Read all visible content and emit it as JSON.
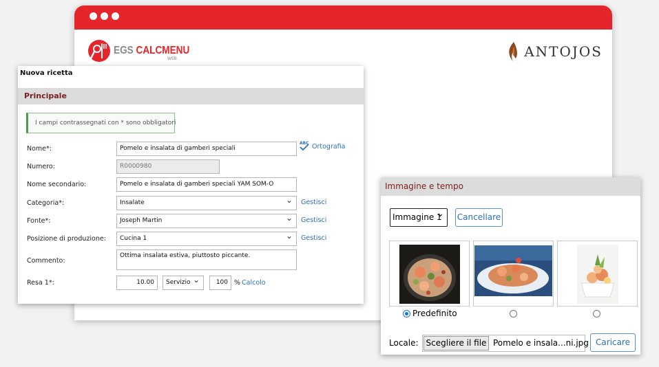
{
  "brand": {
    "egs": "EGS",
    "calcmenu": "CALCMENU",
    "web": "WEB",
    "partner": "ANTOJOS"
  },
  "recipe": {
    "title": "Nuova ricetta",
    "section": "Principale",
    "notice": "I campi contrassegnati con * sono obbligatori",
    "spell_link": "Ortografia",
    "manage_link": "Gestisci",
    "calc_link": "Calcolo",
    "fields": {
      "name": {
        "label": "Nome*:",
        "value": "Pomelo e insalata di gamberi speciali"
      },
      "number": {
        "label": "Numero:",
        "value": "R0000980"
      },
      "secondary_name": {
        "label": "Nome secondario:",
        "value": "Pomelo e insalata di gamberi speciali YAM SOM-O"
      },
      "category": {
        "label": "Categoria*:",
        "value": "Insalate"
      },
      "source": {
        "label": "Fonte*:",
        "value": "Joseph Martin"
      },
      "production": {
        "label": "Posizione di produzione:",
        "value": "Cucina 1"
      },
      "comment": {
        "label": "Commento:",
        "value": "Ottima insalata estiva, piuttosto piccante."
      },
      "yield": {
        "label": "Resa 1*:",
        "value": "10.00",
        "unit": "Servizio",
        "percent": "100",
        "percent_sign": "%"
      }
    }
  },
  "image_panel": {
    "title": "Immagine e tempo",
    "image_select": "Immagine 1",
    "cancel_button": "Cancellare",
    "default_label": "Predefinito",
    "selected_index": 0,
    "locale_label": "Locale:",
    "choose_file_button": "Scegliere il file",
    "file_name": "Pomelo e insala...ni.jpg",
    "upload_button": "Caricare"
  },
  "colors": {
    "brand_red": "#e4252c",
    "section_title": "#7a1f1f",
    "link_blue": "#2e6fb5"
  }
}
